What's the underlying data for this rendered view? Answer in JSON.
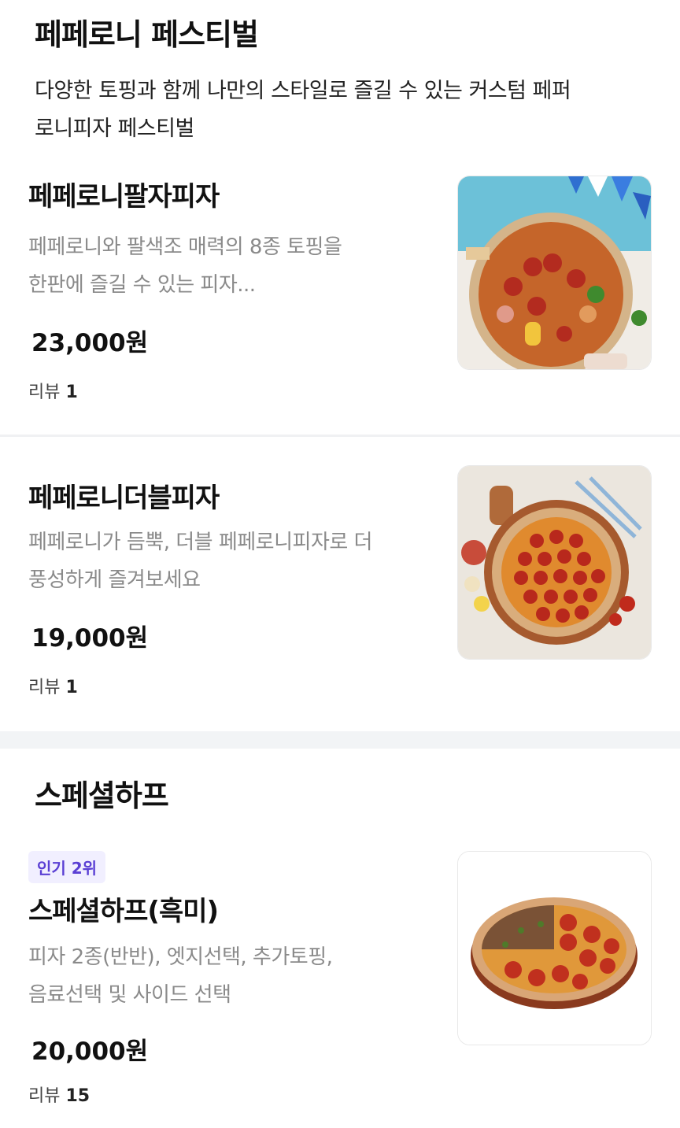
{
  "festival": {
    "title": "페페로니 페스티벌",
    "description_line1": "다양한 토핑과 함께 나만의 스타일로 즐길 수 있는 커스텀 페퍼",
    "description_line2": "로니피자 페스티벌",
    "items": [
      {
        "name": "페페로니팔자피자",
        "desc_line1": "페페로니와 팔색조 매력의 8종 토핑을",
        "desc_line2": "한판에 즐길 수 있는 피자...",
        "price": "23,000원",
        "review_label": "리뷰",
        "review_count": "1"
      },
      {
        "name": "페페로니더블피자",
        "desc_line1": "페페로니가 듬뿍, 더블 페페로니피자로 더",
        "desc_line2": "풍성하게 즐겨보세요",
        "price": "19,000원",
        "review_label": "리뷰",
        "review_count": "1"
      }
    ]
  },
  "special": {
    "title": "스페셜하프",
    "items": [
      {
        "badge": "인기 2위",
        "name": "스페셜하프(흑미)",
        "desc_line1": "피자 2종(반반), 엣지선택, 추가토핑,",
        "desc_line2": "음료선택 및 사이드 선택",
        "price": "20,000원",
        "review_label": "리뷰",
        "review_count": "15"
      }
    ]
  },
  "colors": {
    "badge_text": "#5a3fd4",
    "badge_bg": "#f1efff",
    "desc_gray": "#8a8a8a",
    "divider": "#f2f4f6"
  }
}
